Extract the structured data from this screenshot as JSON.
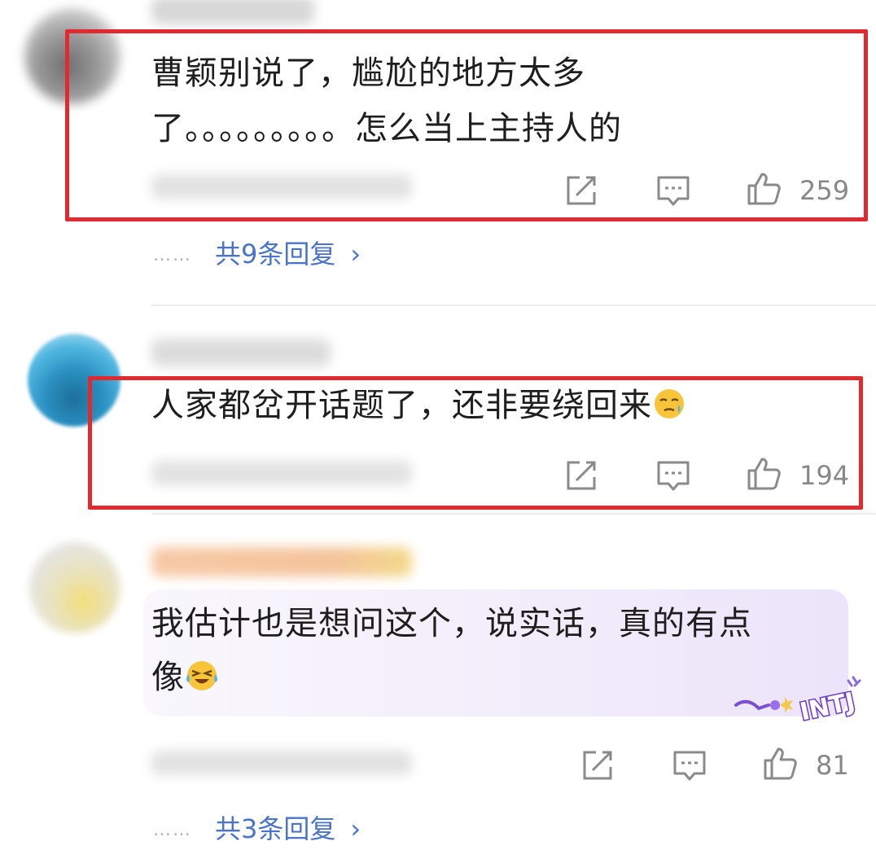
{
  "comments": [
    {
      "text_line1": "曹颖别说了，尴尬的地方太多",
      "text_line2": "了。。。。。。。。。怎么当上主持人的",
      "likes": "259",
      "replies": "共9条回复"
    },
    {
      "text": "人家都岔开话题了，还非要绕回来",
      "likes": "194",
      "emoji": "sweat-face-emoji"
    },
    {
      "text_line1": "我估计也是想问这个，说实话，真的有点",
      "text_line2": "像",
      "likes": "81",
      "replies": "共3条回复",
      "emoji": "laughing-tears-emoji",
      "badge": "INTJ"
    }
  ],
  "colors": {
    "highlight": "#e02a2f",
    "reply_link": "#4a74c9",
    "bubble": "#f3eefb"
  }
}
